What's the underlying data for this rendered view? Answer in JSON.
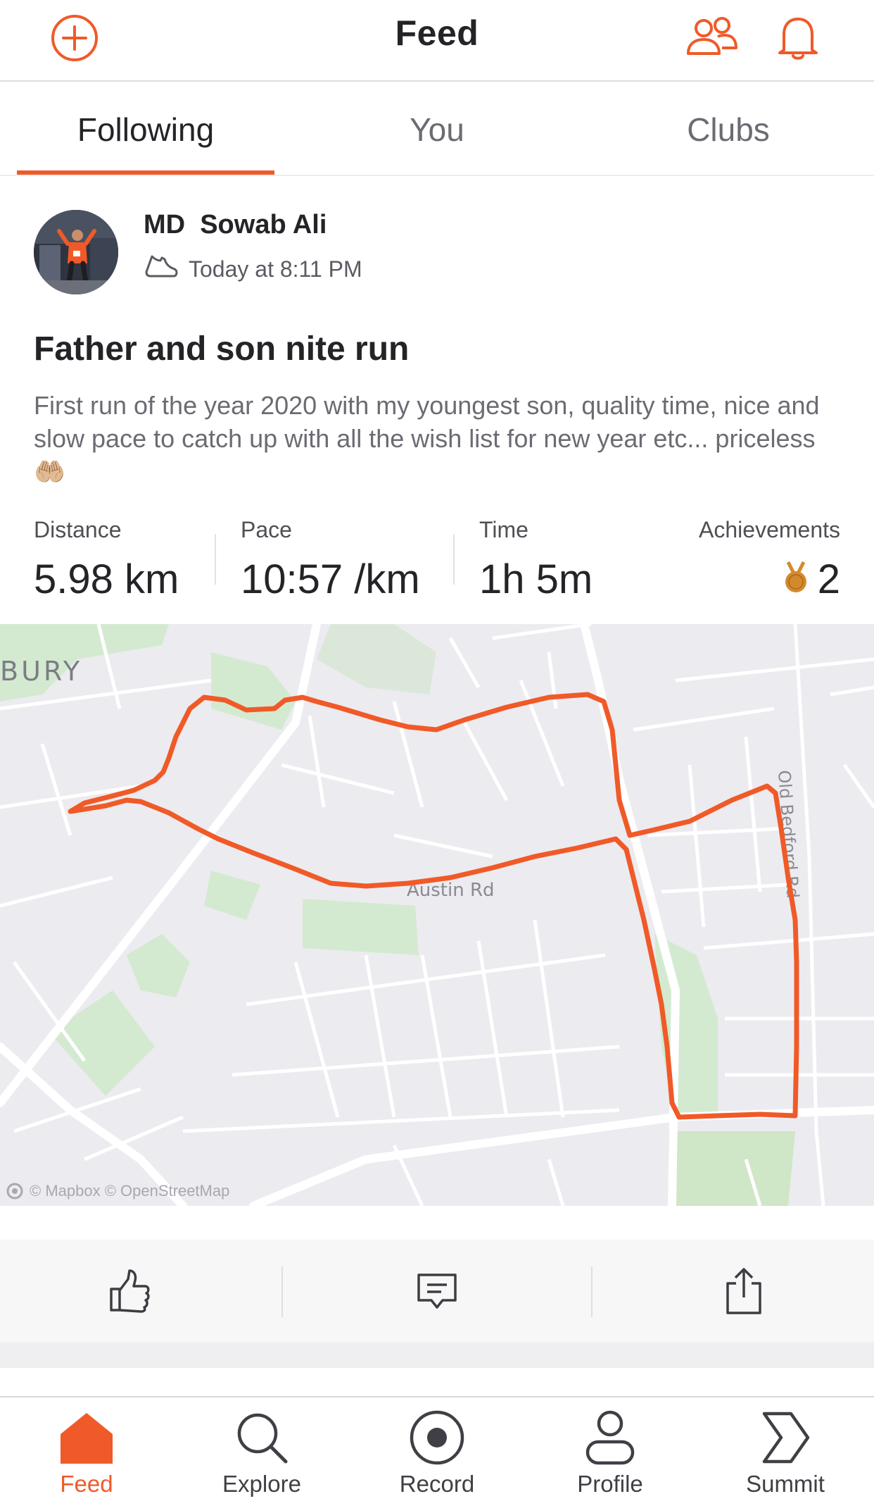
{
  "header": {
    "title": "Feed",
    "add_icon": "plus-circle-icon",
    "people_icon": "people-icon",
    "bell_icon": "bell-icon"
  },
  "tabs": [
    {
      "label": "Following",
      "active": true
    },
    {
      "label": "You",
      "active": false
    },
    {
      "label": "Clubs",
      "active": false
    }
  ],
  "post": {
    "athlete_name": "MD  Sowab Ali",
    "timestamp": "Today at 8:11 PM",
    "activity_type_icon": "shoe-icon",
    "title": "Father and son nite run",
    "description": "First run of the year 2020 with my youngest son, quality time, nice and slow pace to catch up with all the wish list for new year etc... priceless 🤲🏼",
    "stats": {
      "distance": {
        "label": "Distance",
        "value": "5.98 km"
      },
      "pace": {
        "label": "Pace",
        "value": "10:57 /km"
      },
      "time": {
        "label": "Time",
        "value": "1h 5m"
      },
      "achievements": {
        "label": "Achievements",
        "value": "2",
        "icon": "medal-icon"
      }
    },
    "map": {
      "area_label": "BURY",
      "road_label_1": "Austin Rd",
      "road_label_2": "Old Bedford Rd",
      "attribution": "© Mapbox © OpenStreetMap",
      "route_color": "#f05a28"
    }
  },
  "actions": {
    "kudos_icon": "thumbs-up-icon",
    "comment_icon": "comment-icon",
    "share_icon": "share-icon"
  },
  "bottom_nav": [
    {
      "label": "Feed",
      "icon": "home-icon",
      "active": true
    },
    {
      "label": "Explore",
      "icon": "search-icon",
      "active": false
    },
    {
      "label": "Record",
      "icon": "record-icon",
      "active": false
    },
    {
      "label": "Profile",
      "icon": "profile-icon",
      "active": false
    },
    {
      "label": "Summit",
      "icon": "summit-icon",
      "active": false
    }
  ],
  "colors": {
    "accent": "#f05a28",
    "text": "#242428",
    "muted": "#6b6b73"
  }
}
